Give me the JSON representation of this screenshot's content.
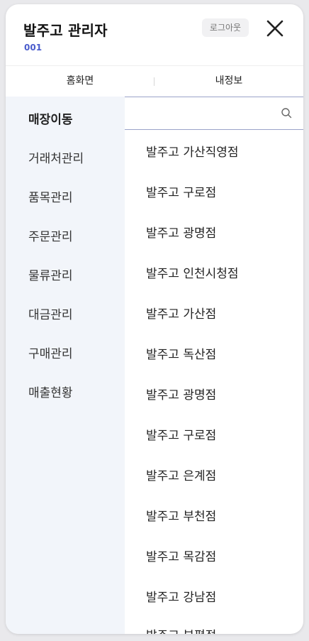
{
  "header": {
    "title": "발주고 관리자",
    "code": "001",
    "logout_label": "로그아웃"
  },
  "tabs": [
    {
      "label": "홈화면"
    },
    {
      "label": "내정보"
    }
  ],
  "sidebar": {
    "items": [
      {
        "label": "매장이동",
        "active": true
      },
      {
        "label": "거래처관리"
      },
      {
        "label": "품목관리"
      },
      {
        "label": "주문관리"
      },
      {
        "label": "물류관리"
      },
      {
        "label": "대금관리"
      },
      {
        "label": "구매관리"
      },
      {
        "label": "매출현황"
      }
    ]
  },
  "search": {
    "value": "",
    "placeholder": ""
  },
  "stores": [
    "발주고 가산직영점",
    "발주고 구로점",
    "발주고 광명점",
    "발주고 인천시청점",
    "발주고 가산점",
    "발주고 독산점",
    "발주고 광명점",
    "발주고 구로점",
    "발주고 은계점",
    "발주고 부천점",
    "발주고 목감점",
    "발주고 강남점",
    "발주고 부평점"
  ],
  "colors": {
    "accent": "#4a5ccc",
    "sidebar_bg": "#f2f5fa",
    "divider": "#9aa3c9"
  },
  "icons": {
    "close": "close-icon",
    "search": "search-icon"
  }
}
